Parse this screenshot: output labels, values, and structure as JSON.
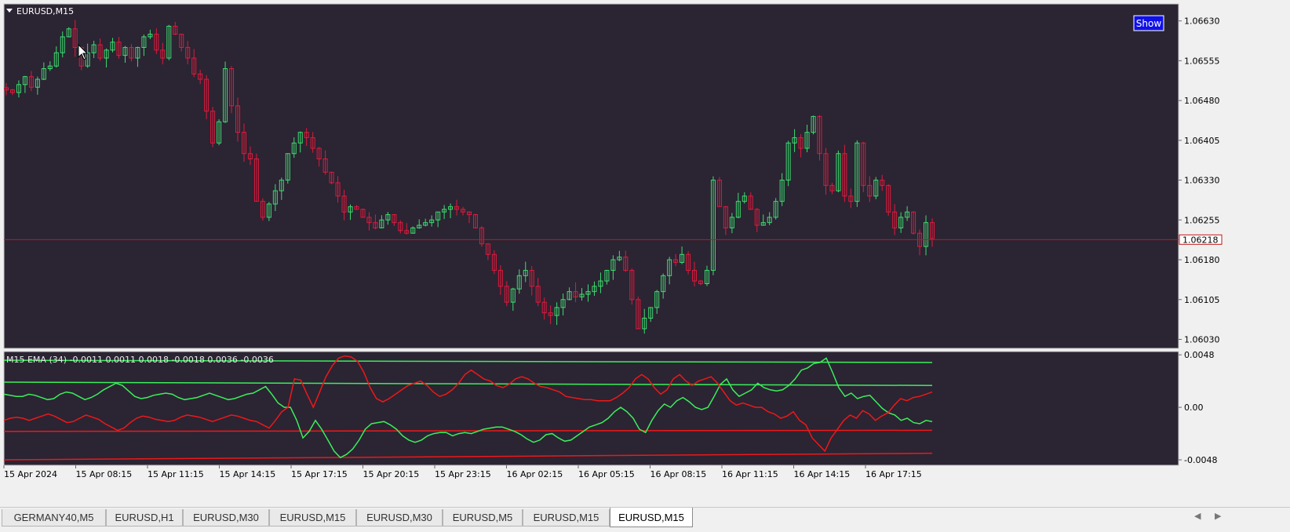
{
  "symbol_title": "EURUSD,M15",
  "show_button": "Show",
  "price_axis": {
    "ticks": [
      1.0663,
      1.06555,
      1.0648,
      1.06405,
      1.0633,
      1.06255,
      1.0618,
      1.06105,
      1.0603
    ],
    "tick_labels": [
      "1.06630",
      "1.06555",
      "1.06480",
      "1.06405",
      "1.06330",
      "1.06255",
      "1.06180",
      "1.06105",
      "1.06030"
    ],
    "current_price": 1.06218,
    "current_price_label": "1.06218",
    "ylim": [
      1.06013,
      1.06662
    ]
  },
  "time_axis": {
    "labels": [
      "15 Apr 2024",
      "15 Apr 08:15",
      "15 Apr 11:15",
      "15 Apr 14:15",
      "15 Apr 17:15",
      "15 Apr 20:15",
      "15 Apr 23:15",
      "16 Apr 02:15",
      "16 Apr 05:15",
      "16 Apr 08:15",
      "16 Apr 11:15",
      "16 Apr 14:15",
      "16 Apr 17:15"
    ]
  },
  "indicator": {
    "label": "M15 EMA (34) -0.0011 0.0011 0.0018 -0.0018 0.0036 -0.0036",
    "ticks": [
      0.0048,
      0.0,
      -0.0048
    ],
    "tick_labels": [
      "0.0048",
      "0.00",
      "-0.0048"
    ],
    "ylim": [
      -0.0053,
      0.0051
    ]
  },
  "colors": {
    "background": "#2b2433",
    "bull": "#3ddc6e",
    "bear": "#e01a3c",
    "grid_frame": "#c8c8c8",
    "price_line": "#c81414",
    "ind_green": "#3aef5a",
    "ind_red": "#ee1818",
    "show_button_bg": "#1010e8"
  },
  "tabs": [
    {
      "label": "GERMANY40,M5",
      "active": false
    },
    {
      "label": "EURUSD,H1",
      "active": false
    },
    {
      "label": "EURUSD,M30",
      "active": false
    },
    {
      "label": "EURUSD,M15",
      "active": false
    },
    {
      "label": "EURUSD,M30",
      "active": false
    },
    {
      "label": "EURUSD,M5",
      "active": false
    },
    {
      "label": "EURUSD,M15",
      "active": false
    },
    {
      "label": "EURUSD,M15",
      "active": true
    }
  ],
  "chart_data": {
    "type": "candlestick",
    "symbol": "EURUSD",
    "timeframe": "M15",
    "close_path": [
      1.065,
      1.06495,
      1.0651,
      1.06525,
      1.06505,
      1.0652,
      1.0654,
      1.06545,
      1.0657,
      1.066,
      1.06615,
      1.0658,
      1.06545,
      1.0657,
      1.06585,
      1.0656,
      1.06575,
      1.0659,
      1.06565,
      1.0658,
      1.0656,
      1.0658,
      1.066,
      1.06605,
      1.06575,
      1.0656,
      1.0662,
      1.06605,
      1.0658,
      1.0656,
      1.0653,
      1.0652,
      1.0646,
      1.064,
      1.0644,
      1.0654,
      1.0647,
      1.0642,
      1.0638,
      1.0637,
      1.0629,
      1.0626,
      1.06285,
      1.0631,
      1.0633,
      1.0638,
      1.064,
      1.0642,
      1.0641,
      1.0639,
      1.0637,
      1.06345,
      1.06325,
      1.063,
      1.0627,
      1.0628,
      1.06275,
      1.0626,
      1.0625,
      1.0624,
      1.06255,
      1.06265,
      1.0625,
      1.06235,
      1.0623,
      1.0624,
      1.06245,
      1.0625,
      1.06255,
      1.0627,
      1.06275,
      1.0628,
      1.06275,
      1.0627,
      1.06265,
      1.0624,
      1.0621,
      1.0619,
      1.0616,
      1.0613,
      1.061,
      1.06125,
      1.0615,
      1.0616,
      1.0613,
      1.061,
      1.0608,
      1.06075,
      1.0609,
      1.06105,
      1.0612,
      1.0611,
      1.06115,
      1.0612,
      1.0613,
      1.0614,
      1.0616,
      1.0618,
      1.06185,
      1.0616,
      1.06105,
      1.0605,
      1.0607,
      1.0609,
      1.0612,
      1.0615,
      1.0618,
      1.06175,
      1.0619,
      1.0616,
      1.0614,
      1.06135,
      1.0616,
      1.0633,
      1.0628,
      1.0624,
      1.0626,
      1.0629,
      1.063,
      1.06275,
      1.06245,
      1.0625,
      1.0626,
      1.0629,
      1.0633,
      1.064,
      1.0641,
      1.0639,
      1.0642,
      1.0645,
      1.0638,
      1.0632,
      1.0631,
      1.0638,
      1.063,
      1.0629,
      1.064,
      1.0632,
      1.063,
      1.0633,
      1.0632,
      1.0627,
      1.0624,
      1.0626,
      1.0627,
      1.0623,
      1.06205,
      1.0625,
      1.0622
    ],
    "current_price": 1.06218,
    "indicator": {
      "name": "M15 EMA (34)",
      "levels": [
        -0.0011,
        0.0011,
        0.0018,
        -0.0018,
        0.0036,
        -0.0036
      ],
      "ylim": [
        -0.0053,
        0.0051
      ],
      "series": [
        {
          "color": "green",
          "values": [
            0.0012,
            0.0011,
            0.001,
            0.001,
            0.0012,
            0.0011,
            0.0009,
            0.0007,
            0.0008,
            0.0012,
            0.0014,
            0.0013,
            0.001,
            0.0007,
            0.0009,
            0.0012,
            0.0016,
            0.0019,
            0.0022,
            0.002,
            0.0015,
            0.001,
            0.0008,
            0.0009,
            0.0011,
            0.0012,
            0.0013,
            0.0012,
            0.0009,
            0.0007,
            0.0008,
            0.0009,
            0.0011,
            0.0013,
            0.0011,
            0.0009,
            0.0007,
            0.0008,
            0.001,
            0.0012,
            0.0013,
            0.0016,
            0.0019,
            0.0012,
            0.0004,
            0.0,
            0.0,
            -0.0012,
            -0.0028,
            -0.0022,
            -0.0012,
            -0.002,
            -0.003,
            -0.004,
            -0.0046,
            -0.0043,
            -0.0038,
            -0.003,
            -0.002,
            -0.0015,
            -0.0014,
            -0.0013,
            -0.0016,
            -0.002,
            -0.0026,
            -0.003,
            -0.0032,
            -0.003,
            -0.0026,
            -0.0024,
            -0.0023,
            -0.0023,
            -0.0026,
            -0.0024,
            -0.0023,
            -0.0024,
            -0.0022,
            -0.002,
            -0.0019,
            -0.0018,
            -0.0018,
            -0.002,
            -0.0022,
            -0.0025,
            -0.0029,
            -0.0032,
            -0.003,
            -0.0025,
            -0.0024,
            -0.0028,
            -0.0031,
            -0.003,
            -0.0026,
            -0.0022,
            -0.0018,
            -0.0016,
            -0.0014,
            -0.001,
            -0.0004,
            0.0,
            -0.0004,
            -0.001,
            -0.002,
            -0.0023,
            -0.0012,
            -0.0003,
            0.0003,
            0.0,
            0.0006,
            0.0009,
            0.0005,
            0.0,
            -0.0002,
            0.0,
            0.001,
            0.0021,
            0.0026,
            0.0016,
            0.001,
            0.0013,
            0.0016,
            0.0022,
            0.0018,
            0.0016,
            0.0015,
            0.0016,
            0.002,
            0.0026,
            0.0034,
            0.0036,
            0.004,
            0.0041,
            0.0045,
            0.0032,
            0.0018,
            0.001,
            0.0013,
            0.0008,
            0.001,
            0.0011,
            0.0005,
            -0.0001,
            -0.0005,
            -0.0007,
            -0.0012,
            -0.001,
            -0.0014,
            -0.0015,
            -0.0012,
            -0.0013
          ]
        },
        {
          "color": "red",
          "values": [
            -0.0012,
            -0.001,
            -0.0009,
            -0.001,
            -0.0012,
            -0.001,
            -0.0008,
            -0.0006,
            -0.0008,
            -0.0011,
            -0.0014,
            -0.0013,
            -0.001,
            -0.0007,
            -0.0009,
            -0.0011,
            -0.0015,
            -0.0018,
            -0.0021,
            -0.0019,
            -0.0014,
            -0.001,
            -0.0008,
            -0.0009,
            -0.0011,
            -0.0012,
            -0.0013,
            -0.0012,
            -0.0009,
            -0.0007,
            -0.0008,
            -0.0009,
            -0.0011,
            -0.0013,
            -0.0011,
            -0.0009,
            -0.0007,
            -0.0008,
            -0.001,
            -0.0012,
            -0.0013,
            -0.0016,
            -0.0019,
            -0.0012,
            -0.0004,
            0.0,
            0.0026,
            0.0025,
            0.0012,
            0.0,
            0.0014,
            0.0028,
            0.0038,
            0.0045,
            0.0047,
            0.0046,
            0.0042,
            0.0032,
            0.0018,
            0.0008,
            0.0005,
            0.0008,
            0.0012,
            0.0016,
            0.002,
            0.0022,
            0.0024,
            0.002,
            0.0014,
            0.001,
            0.0012,
            0.0016,
            0.0022,
            0.003,
            0.0034,
            0.003,
            0.0026,
            0.0024,
            0.002,
            0.0018,
            0.0021,
            0.0026,
            0.0028,
            0.0026,
            0.0022,
            0.0019,
            0.0018,
            0.0016,
            0.0014,
            0.001,
            0.0009,
            0.0008,
            0.0007,
            0.0007,
            0.0006,
            0.0006,
            0.0006,
            0.0009,
            0.0013,
            0.0018,
            0.0026,
            0.003,
            0.0026,
            0.0018,
            0.0012,
            0.0016,
            0.0026,
            0.003,
            0.0024,
            0.002,
            0.0024,
            0.0026,
            0.0028,
            0.0022,
            0.0014,
            0.0006,
            0.0002,
            0.0004,
            0.0002,
            0.0,
            0.0,
            -0.0004,
            -0.0006,
            -0.001,
            -0.0008,
            -0.0004,
            -0.0012,
            -0.0016,
            -0.0028,
            -0.0034,
            -0.004,
            -0.0028,
            -0.002,
            -0.0012,
            -0.0007,
            -0.001,
            -0.0003,
            -0.0006,
            -0.0012,
            -0.0008,
            -0.0005,
            0.0002,
            0.0008,
            0.0006,
            0.0009,
            0.001,
            0.0012,
            0.0014
          ]
        }
      ]
    }
  }
}
